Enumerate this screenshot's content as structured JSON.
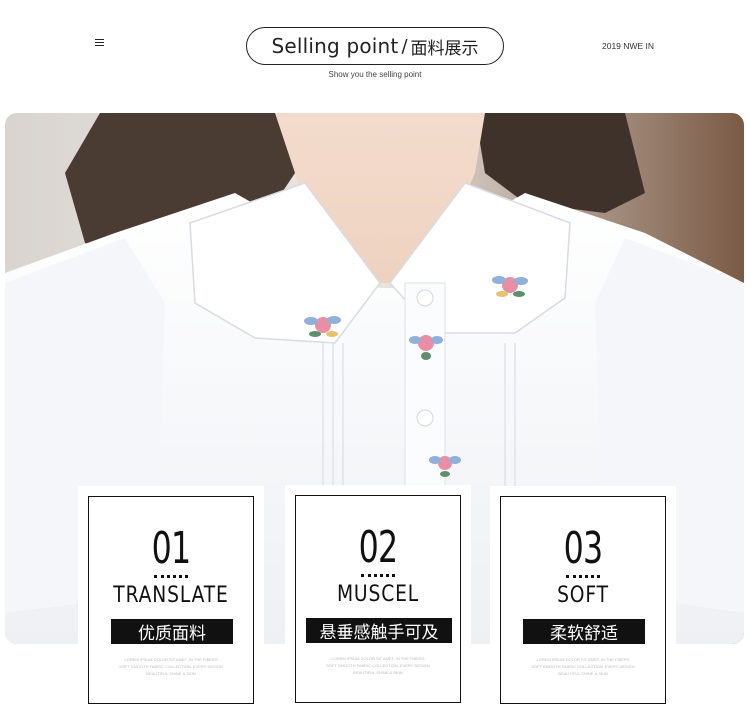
{
  "header": {
    "menu_icon": "menu-icon",
    "title_en": "Selling point",
    "title_sep": "/",
    "title_cn": "面料展示",
    "subtitle": "Show you the selling point",
    "year_tag": "2019 NWE IN"
  },
  "photo": {
    "subject": "white puff-sleeve blouse with embroidered flowers on collar"
  },
  "cards": [
    {
      "number": "01",
      "word": "TRANSLATE",
      "cn_label": "优质面料",
      "fine_lines": [
        "LOREM IPSUM DOLOR SIT AMET, IN THE FIBERS",
        "SOFT SMOOTH FABRIC COLLECTION, EVERY DESIGN",
        "BEAUTIFUL SHINE & SKIN"
      ]
    },
    {
      "number": "02",
      "word": "MUSCEL",
      "cn_label": "悬垂感触手可及",
      "fine_lines": [
        "LOREM IPSUM DOLOR SIT AMET, IN THE FIBERS",
        "SOFT SMOOTH FABRIC COLLECTION, EVERY DESIGN",
        "BEAUTIFUL SHINE & SKIN"
      ]
    },
    {
      "number": "03",
      "word": "SOFT",
      "cn_label": "柔软舒适",
      "fine_lines": [
        "LOREM IPSUM DOLOR SIT AMET, IN THE FIBERS",
        "SOFT SMOOTH FABRIC COLLECTION, EVERY DESIGN",
        "BEAUTIFUL SHINE & SKIN"
      ]
    }
  ],
  "colors": {
    "ink": "#111111",
    "blouse": "#f7f8fa",
    "hair": "#4a3b33",
    "background": "#ffffff"
  }
}
